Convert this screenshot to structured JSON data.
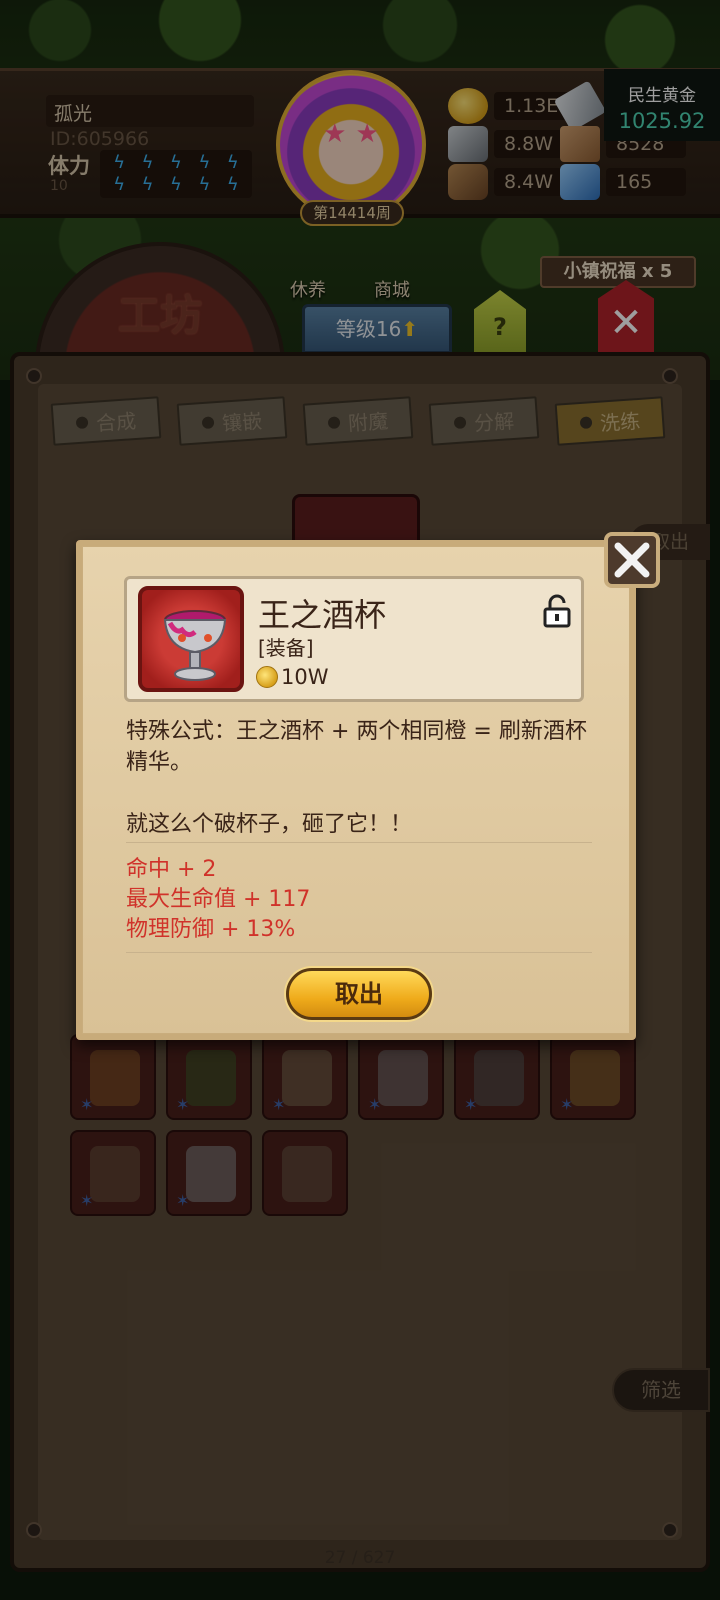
{
  "overlay": {
    "title": "民生黄金",
    "value": "1025.92"
  },
  "player": {
    "name": "孤光",
    "id": "ID:605966",
    "stamina_label": "体力",
    "stamina_value": "10",
    "week": "第14414周"
  },
  "resources": [
    {
      "icon": "gold-coin-icon",
      "value": "1.13E"
    },
    {
      "icon": "iron-ingot-icon",
      "value": ""
    },
    {
      "icon": "ore-icon",
      "value": "8.8W"
    },
    {
      "icon": "hide-icon",
      "value": "8528"
    },
    {
      "icon": "wood-log-icon",
      "value": "8.4W"
    },
    {
      "icon": "crystal-icon",
      "value": "165"
    }
  ],
  "town": {
    "buildings": [
      "休养",
      "商城"
    ],
    "blessing": "小镇祝福 x 5"
  },
  "workshop": {
    "title": "工坊",
    "level_label": "等级16",
    "help": "?",
    "tabs": [
      "合成",
      "镶嵌",
      "附魔",
      "分解",
      "洗练"
    ],
    "active_tab": "洗练",
    "take_out_behind": "取出",
    "filter": "筛选",
    "pager": "27 / 627"
  },
  "modal": {
    "item_name": "王之酒杯",
    "item_type": "[装备]",
    "price": "10W",
    "description": "特殊公式：王之酒杯 + 两个相同橙 = 刷新酒杯精华。",
    "flavor": "就这么个破杯子，砸了它！！",
    "stats": [
      "命中 + 2",
      "最大生命值 + 117",
      "物理防御 + 13%"
    ],
    "take_out_label": "取出"
  },
  "colors": {
    "stat_red": "#d0322a",
    "button_gold": "#efab1b",
    "panel_brown": "#4b3c2d"
  }
}
